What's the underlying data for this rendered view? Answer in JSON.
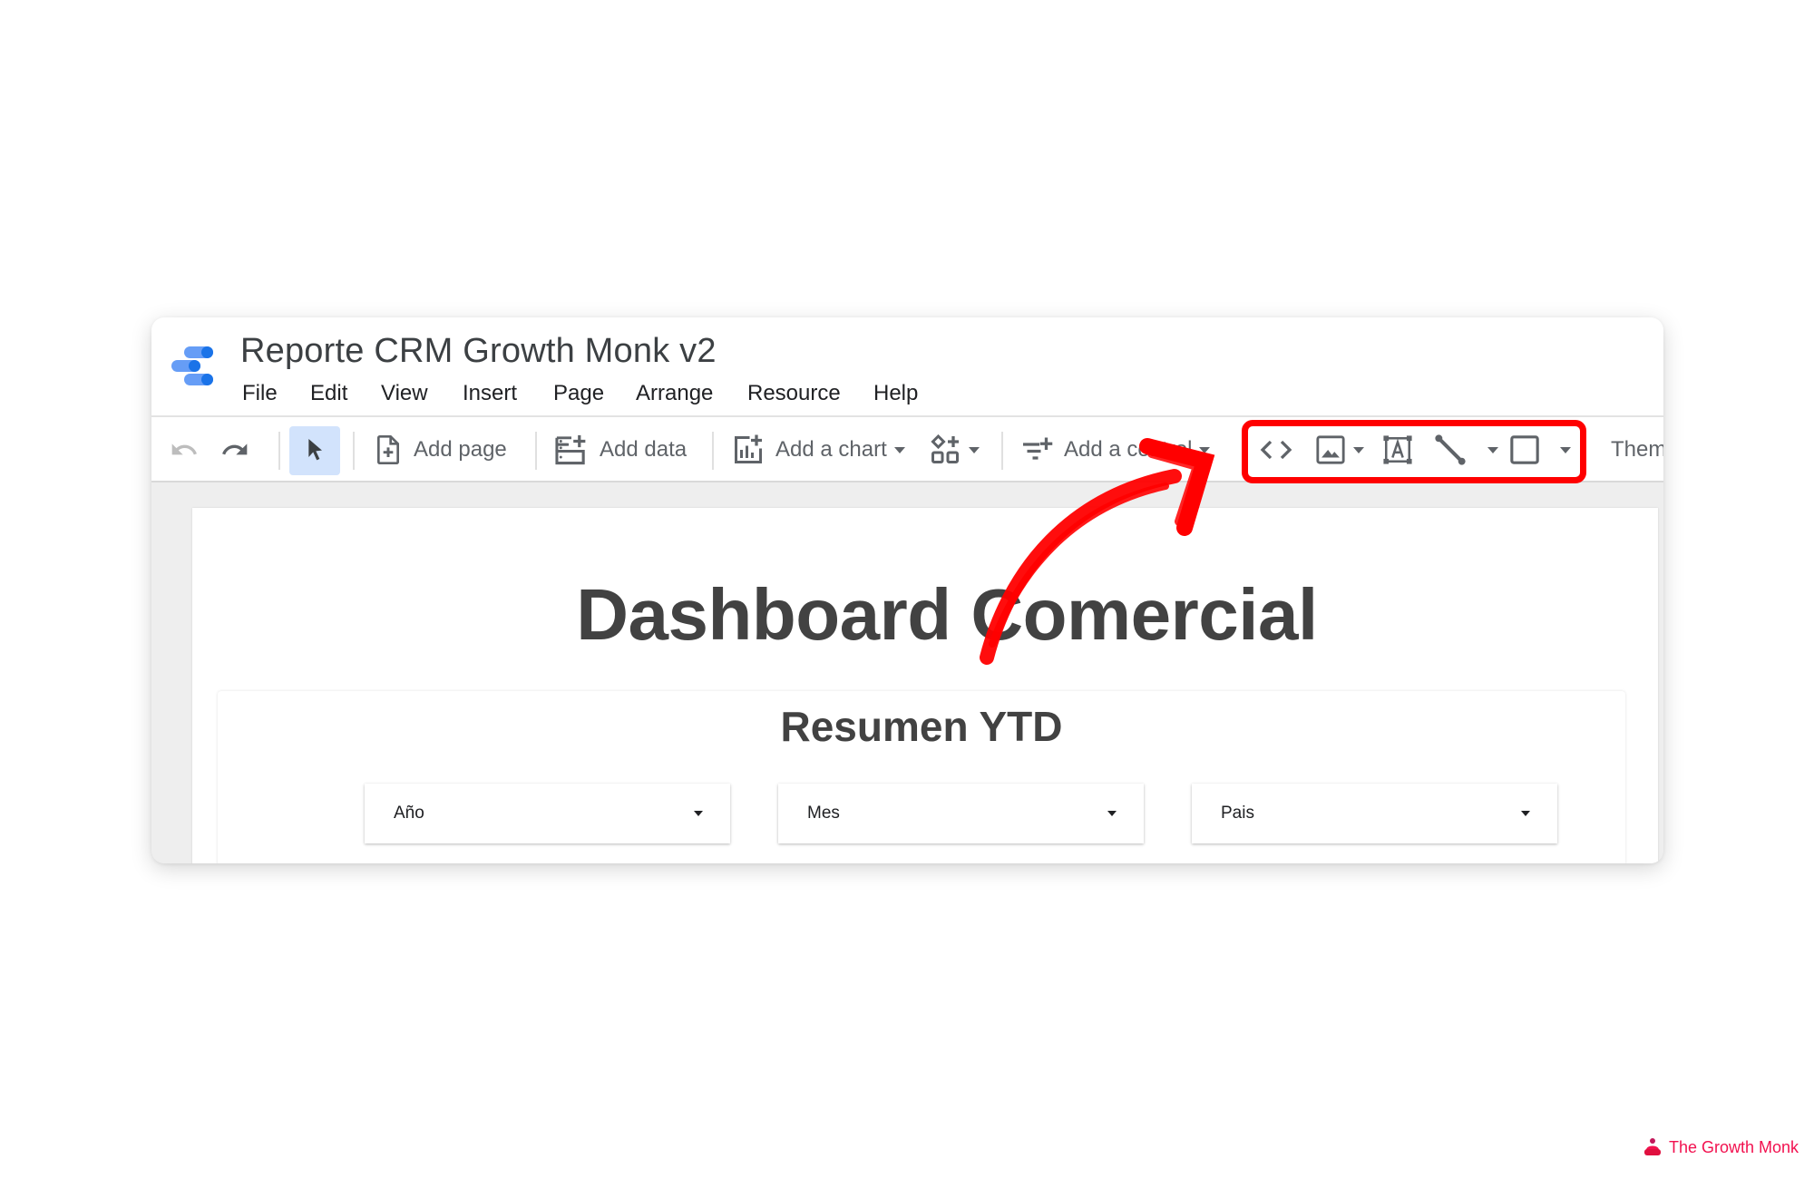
{
  "app": {
    "title": "Reporte CRM Growth Monk v2",
    "logo": "looker-studio-logo",
    "brand_color": "#1a73e8"
  },
  "menu": {
    "items": [
      {
        "label": "File"
      },
      {
        "label": "Edit"
      },
      {
        "label": "View"
      },
      {
        "label": "Insert"
      },
      {
        "label": "Page"
      },
      {
        "label": "Arrange"
      },
      {
        "label": "Resource"
      },
      {
        "label": "Help"
      }
    ]
  },
  "toolbar": {
    "undo": {
      "icon": "undo-icon",
      "enabled": false
    },
    "redo": {
      "icon": "redo-icon",
      "enabled": true
    },
    "select": {
      "icon": "cursor-arrow-icon",
      "active": true
    },
    "add_page": {
      "icon": "add-page-icon",
      "label": "Add page"
    },
    "add_data": {
      "icon": "add-data-icon",
      "label": "Add data"
    },
    "add_chart": {
      "icon": "add-chart-icon",
      "label": "Add a chart"
    },
    "community_viz": {
      "icon": "community-visualizations-icon"
    },
    "add_control": {
      "icon": "add-control-icon",
      "label": "Add a control"
    },
    "embed": {
      "icon": "code-embed-icon"
    },
    "image": {
      "icon": "image-icon"
    },
    "text": {
      "icon": "text-box-icon"
    },
    "line": {
      "icon": "line-icon"
    },
    "shape": {
      "icon": "rectangle-shape-icon"
    },
    "theme": {
      "label": "Them"
    }
  },
  "report": {
    "title": "Dashboard Comercial",
    "section_title": "Resumen YTD",
    "filters": [
      {
        "label": "Año"
      },
      {
        "label": "Mes"
      },
      {
        "label": "Pais"
      }
    ]
  },
  "annotation": {
    "highlight_color": "#ff0000",
    "target": "Insert tools group (embed, image, text, line, shape)"
  },
  "watermark": {
    "text": "The Growth Monk",
    "color": "#f2114f"
  }
}
